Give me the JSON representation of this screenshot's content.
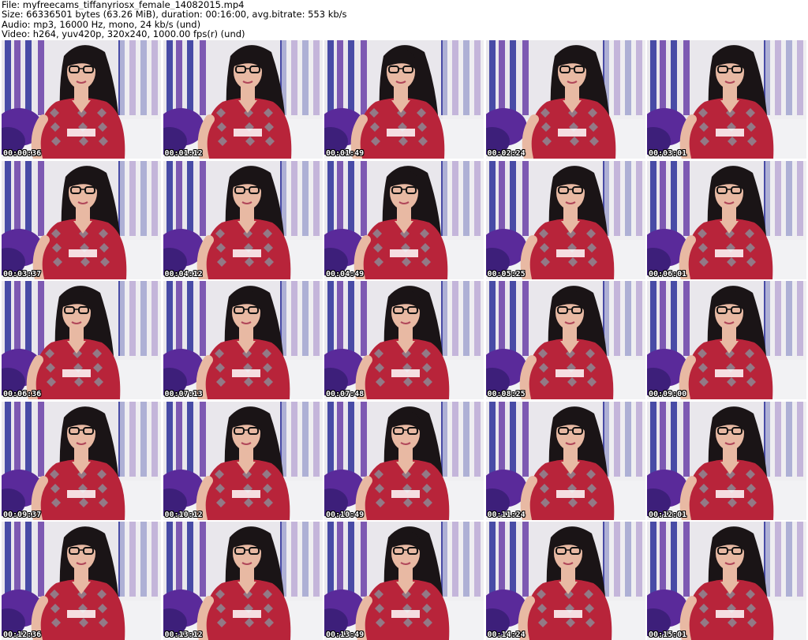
{
  "header": {
    "file_line": "File: myfreecams_tiffanyriosx_female_14082015.mp4",
    "size_line": "Size: 66336501 bytes (63.26 MiB), duration: 00:16:00, avg.bitrate: 553 kb/s",
    "audio_line": "Audio: mp3, 16000 Hz, mono, 24 kb/s (und)",
    "video_line": "Video: h264, yuv420p, 320x240, 1000.00 fps(r) (und)"
  },
  "thumbnails": [
    {
      "timestamp": "00:00:36"
    },
    {
      "timestamp": "00:01:12"
    },
    {
      "timestamp": "00:01:49"
    },
    {
      "timestamp": "00:02:24"
    },
    {
      "timestamp": "00:03:01"
    },
    {
      "timestamp": "00:03:37"
    },
    {
      "timestamp": "00:04:12"
    },
    {
      "timestamp": "00:04:49"
    },
    {
      "timestamp": "00:05:25"
    },
    {
      "timestamp": "00:06:01"
    },
    {
      "timestamp": "00:06:36"
    },
    {
      "timestamp": "00:07:13"
    },
    {
      "timestamp": "00:07:48"
    },
    {
      "timestamp": "00:08:25"
    },
    {
      "timestamp": "00:09:00"
    },
    {
      "timestamp": "00:09:37"
    },
    {
      "timestamp": "00:10:12"
    },
    {
      "timestamp": "00:10:49"
    },
    {
      "timestamp": "00:11:24"
    },
    {
      "timestamp": "00:12:01"
    },
    {
      "timestamp": "00:12:36"
    },
    {
      "timestamp": "00:13:12"
    },
    {
      "timestamp": "00:13:49"
    },
    {
      "timestamp": "00:14:24"
    },
    {
      "timestamp": "00:15:01"
    }
  ],
  "colors": {
    "background": "#ffffff",
    "wall": "#e9e7ec",
    "stripe_blue": "#2b2f9a",
    "stripe_violet": "#6a3fa8",
    "pillow": "#5a2a9a",
    "bed": "#f2f2f4",
    "shirt": "#b8243a",
    "hair": "#1a1416",
    "skin": "#e8b9a3"
  }
}
